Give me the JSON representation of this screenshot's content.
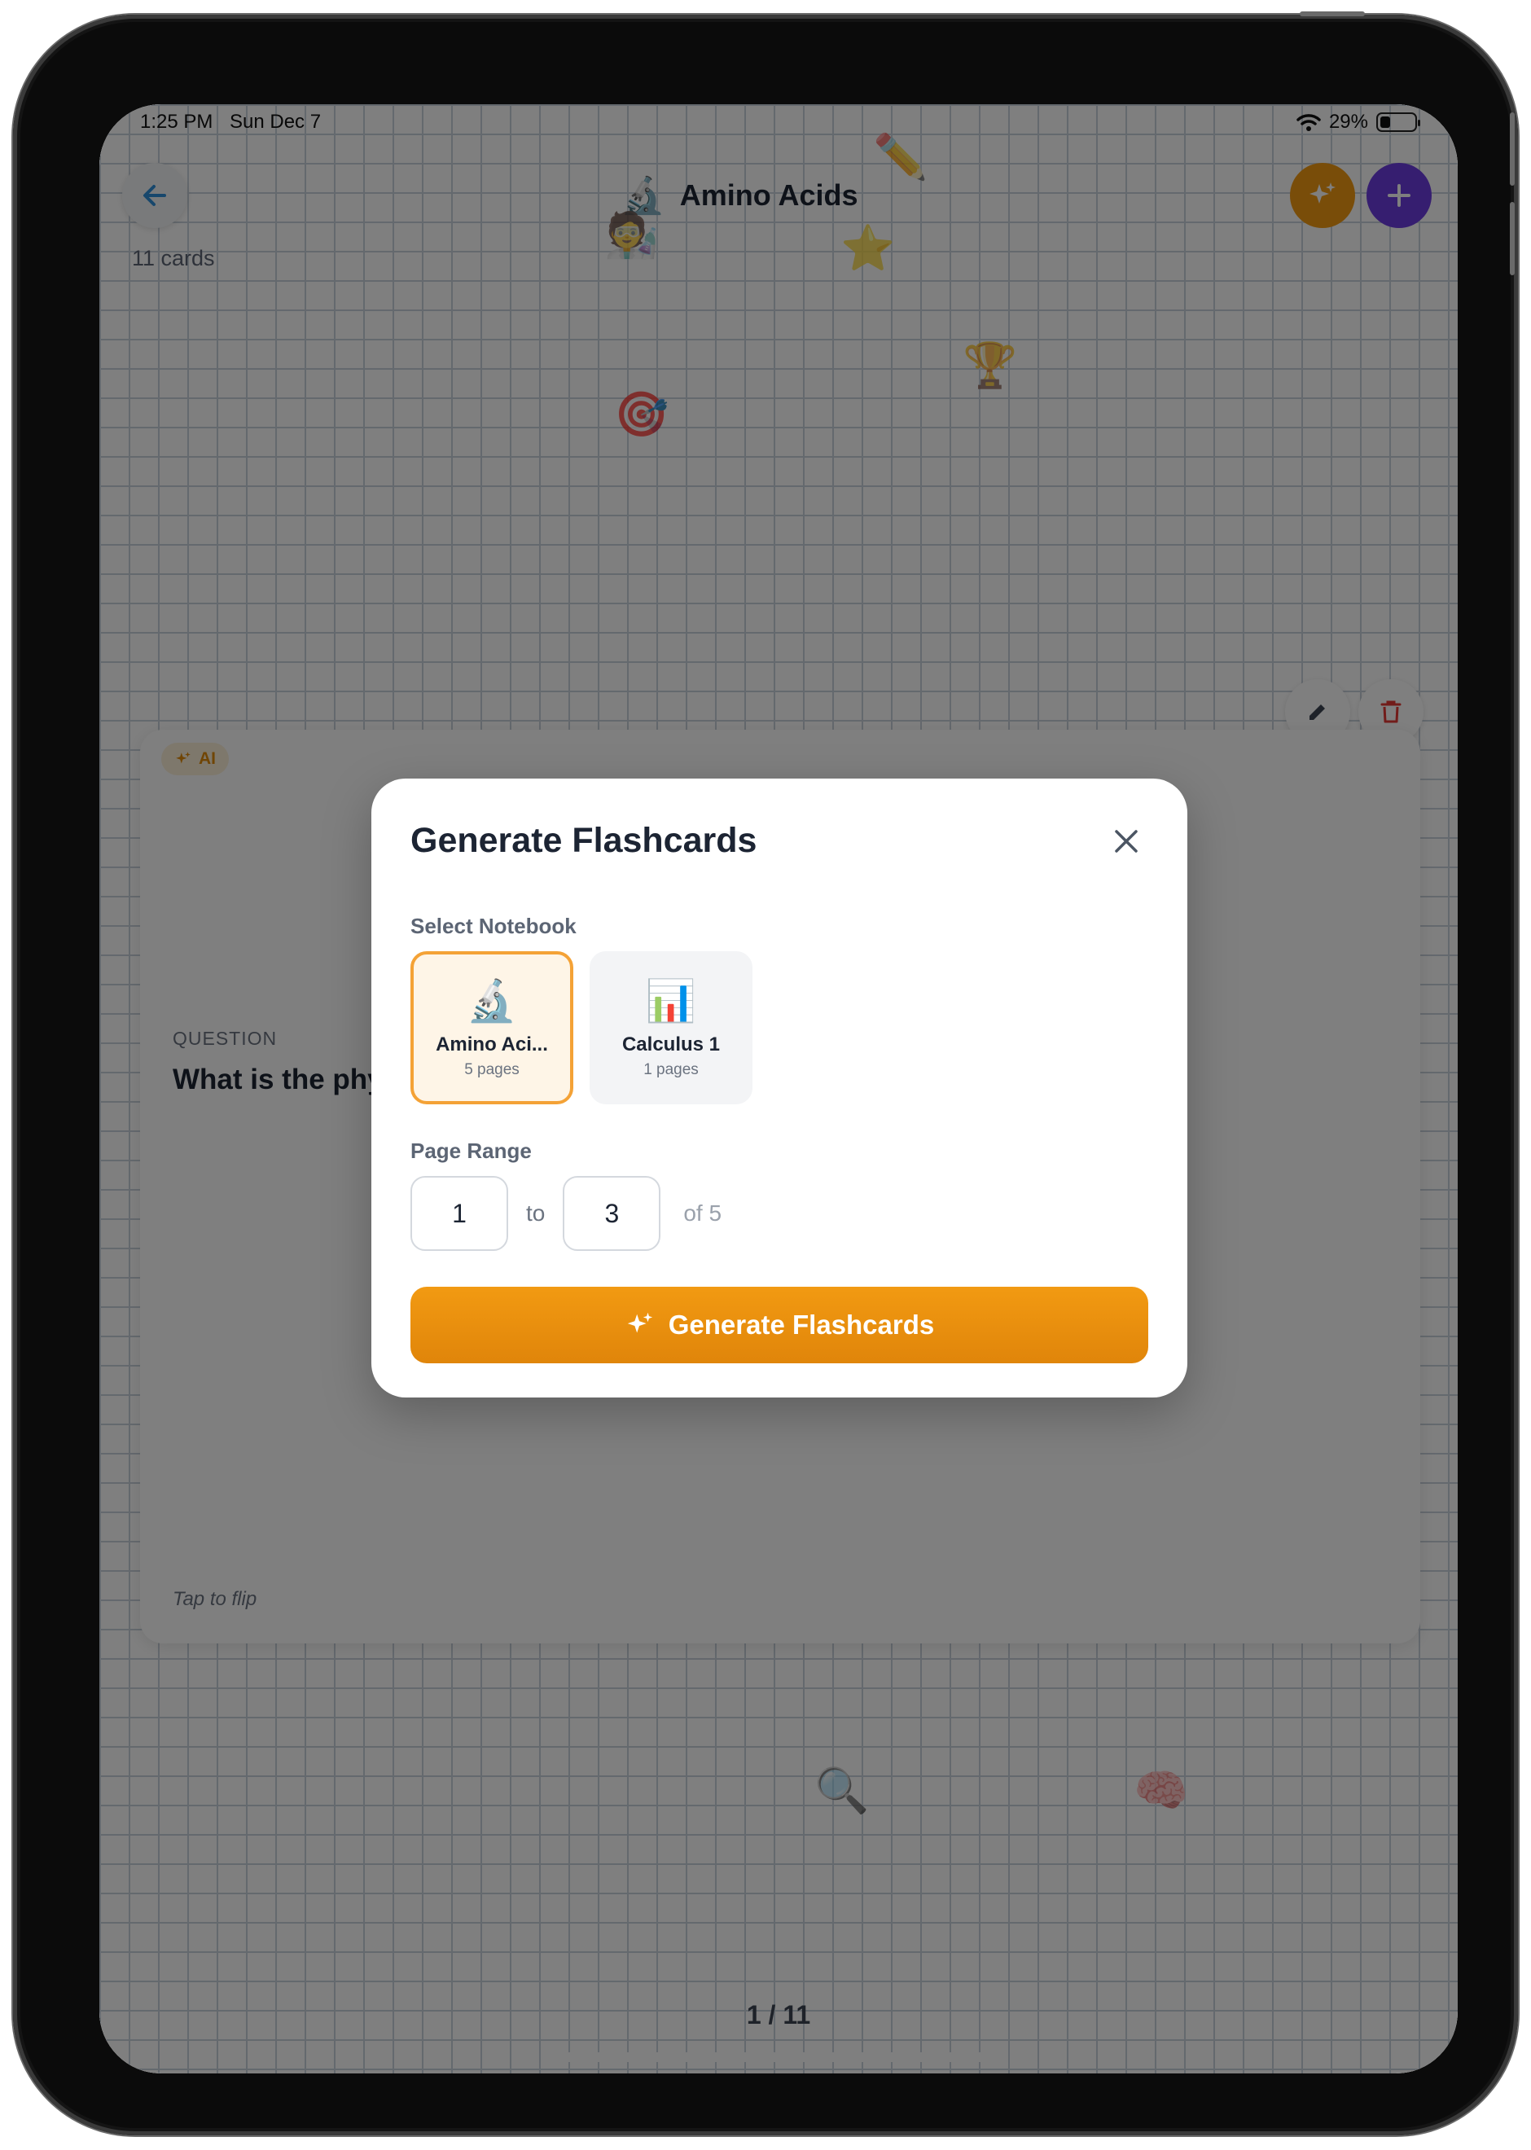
{
  "status_bar": {
    "time": "1:25 PM",
    "date": "Sun Dec 7",
    "battery": "29%"
  },
  "header": {
    "title_emoji": "🔬",
    "title": "Amino Acids",
    "card_count": "11 cards"
  },
  "flashcard": {
    "badge": "AI",
    "question_label": "QUESTION",
    "question_text": "What is the phy",
    "flip_hint": "Tap to flip"
  },
  "pagination": {
    "indicator": "1 / 11"
  },
  "modal": {
    "title": "Generate Flashcards",
    "select_notebook_label": "Select Notebook",
    "notebooks": [
      {
        "emoji": "🔬",
        "name": "Amino Aci...",
        "pages": "5 pages",
        "selected": true
      },
      {
        "emoji": "📊",
        "name": "Calculus 1",
        "pages": "1 pages",
        "selected": false
      }
    ],
    "page_range_label": "Page Range",
    "range_from": "1",
    "range_to_label": "to",
    "range_to": "3",
    "range_total": "of 5",
    "generate_button": "Generate Flashcards"
  },
  "colors": {
    "accent_orange": "#f39a12",
    "accent_purple": "#6c3ce0",
    "selected_border": "#f4a236",
    "delete_red": "#e53935"
  }
}
